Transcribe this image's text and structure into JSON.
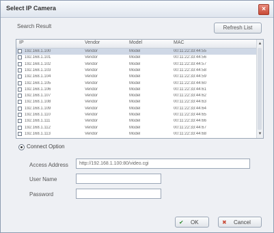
{
  "window": {
    "title": "Select IP Camera",
    "close_label": "×"
  },
  "header": {
    "section_label": "Search Result",
    "refresh_label": "Refresh List"
  },
  "table": {
    "columns": [
      "IP",
      "Vendor",
      "Model",
      "MAC"
    ],
    "rows": [
      {
        "ip": "192.168.1.100",
        "vendor": "Vendor",
        "model": "Model",
        "mac": "00:11:22:33:44:55",
        "selected": true
      },
      {
        "ip": "192.168.1.101",
        "vendor": "Vendor",
        "model": "Model",
        "mac": "00:11:22:33:44:56",
        "selected": false
      },
      {
        "ip": "192.168.1.102",
        "vendor": "Vendor",
        "model": "Model",
        "mac": "00:11:22:33:44:57",
        "selected": false
      },
      {
        "ip": "192.168.1.103",
        "vendor": "Vendor",
        "model": "Model",
        "mac": "00:11:22:33:44:58",
        "selected": false
      },
      {
        "ip": "192.168.1.104",
        "vendor": "Vendor",
        "model": "Model",
        "mac": "00:11:22:33:44:59",
        "selected": false
      },
      {
        "ip": "192.168.1.105",
        "vendor": "Vendor",
        "model": "Model",
        "mac": "00:11:22:33:44:60",
        "selected": false
      },
      {
        "ip": "192.168.1.106",
        "vendor": "Vendor",
        "model": "Model",
        "mac": "00:11:22:33:44:61",
        "selected": false
      },
      {
        "ip": "192.168.1.107",
        "vendor": "Vendor",
        "model": "Model",
        "mac": "00:11:22:33:44:62",
        "selected": false
      },
      {
        "ip": "192.168.1.108",
        "vendor": "Vendor",
        "model": "Model",
        "mac": "00:11:22:33:44:63",
        "selected": false
      },
      {
        "ip": "192.168.1.109",
        "vendor": "Vendor",
        "model": "Model",
        "mac": "00:11:22:33:44:64",
        "selected": false
      },
      {
        "ip": "192.168.1.110",
        "vendor": "Vendor",
        "model": "Model",
        "mac": "00:11:22:33:44:65",
        "selected": false
      },
      {
        "ip": "192.168.1.111",
        "vendor": "Vendor",
        "model": "Model",
        "mac": "00:11:22:33:44:66",
        "selected": false
      },
      {
        "ip": "192.168.1.112",
        "vendor": "Vendor",
        "model": "Model",
        "mac": "00:11:22:33:44:67",
        "selected": false
      },
      {
        "ip": "192.168.1.113",
        "vendor": "Vendor",
        "model": "Model",
        "mac": "00:11:22:33:44:68",
        "selected": false
      }
    ]
  },
  "connect": {
    "radio_label": "Connect Option",
    "address_label": "Access Address",
    "address_value": "http://192.168.1.100:80/video.cgi",
    "username_label": "User Name",
    "username_value": "",
    "password_label": "Password",
    "password_value": ""
  },
  "buttons": {
    "ok_label": "OK",
    "cancel_label": "Cancel"
  },
  "colors": {
    "selected_row": "#cfd8e6",
    "close_button": "#c84b37"
  }
}
